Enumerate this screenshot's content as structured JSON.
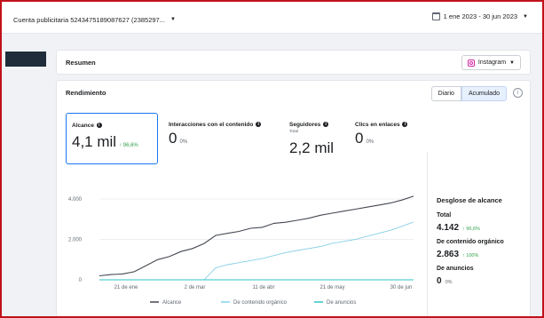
{
  "topbar": {
    "account_label": "Cuenta publicitaria 5243475189087627 (2385297...",
    "date_range": "1 ene 2023 - 30 jun 2023"
  },
  "summary": {
    "title": "Resumen",
    "platform_selector": "Instagram"
  },
  "performance": {
    "title": "Rendimiento",
    "toggle": [
      "Diario",
      "Acumulado"
    ],
    "metrics": [
      {
        "label": "Alcance",
        "value": "4,1 mil",
        "change": "↑ 96,6%",
        "selected": true
      },
      {
        "label": "Interacciones con el contenido",
        "value": "0",
        "change": "0%"
      },
      {
        "label": "Seguidores",
        "sublabel": "Total",
        "value": "2,2 mil",
        "change": ""
      },
      {
        "label": "Clics en enlaces",
        "value": "0",
        "change": "0%"
      }
    ]
  },
  "breakdown": {
    "title": "Desglose de alcance",
    "items": [
      {
        "label": "Total",
        "value": "4.142",
        "change": "↑ 96,6%"
      },
      {
        "label": "De contenido orgánico",
        "value": "2.863",
        "change": "↑ 100%"
      },
      {
        "label": "De anuncios",
        "value": "0",
        "change": "0%"
      }
    ]
  },
  "colors": {
    "alcance": "#444950",
    "organico": "#86d0e8",
    "anuncios": "#2ec6c6",
    "accent": "#1877f2",
    "positive": "#31a24c"
  },
  "chart_data": {
    "type": "line",
    "x": [
      "1 ene",
      "8 ene",
      "15 ene",
      "21 ene",
      "29 ene",
      "5 feb",
      "12 feb",
      "19 feb",
      "26 feb",
      "2 mar",
      "9 mar",
      "16 mar",
      "23 mar",
      "30 mar",
      "6 abr",
      "11 abr",
      "18 abr",
      "25 abr",
      "2 may",
      "9 may",
      "16 may",
      "21 may",
      "28 may",
      "4 jun",
      "11 jun",
      "18 jun",
      "25 jun",
      "30 jun"
    ],
    "x_ticks": [
      "21 de ene",
      "2 de mar",
      "11 de abr",
      "21 de may",
      "30 de jun"
    ],
    "y_ticks": [
      "0",
      "2.000",
      "4.000"
    ],
    "ylim": [
      0,
      4400
    ],
    "series": [
      {
        "name": "Alcance",
        "values": [
          200,
          260,
          290,
          400,
          700,
          1000,
          1150,
          1400,
          1550,
          1800,
          2200,
          2300,
          2400,
          2550,
          2600,
          2800,
          2850,
          2950,
          3050,
          3200,
          3300,
          3400,
          3500,
          3600,
          3700,
          3800,
          3950,
          4142
        ]
      },
      {
        "name": "De contenido orgánico",
        "values": [
          0,
          0,
          0,
          0,
          0,
          0,
          0,
          0,
          0,
          0,
          600,
          750,
          850,
          950,
          1050,
          1200,
          1350,
          1450,
          1550,
          1650,
          1800,
          1900,
          2000,
          2150,
          2300,
          2450,
          2650,
          2863
        ]
      },
      {
        "name": "De anuncios",
        "values": [
          0,
          0,
          0,
          0,
          0,
          0,
          0,
          0,
          0,
          0,
          0,
          0,
          0,
          0,
          0,
          0,
          0,
          0,
          0,
          0,
          0,
          0,
          0,
          0,
          0,
          0,
          0,
          0
        ]
      }
    ],
    "legend": [
      "Alcance",
      "De contenido orgánico",
      "De anuncios"
    ],
    "legend_position": "bottom",
    "grid": true
  }
}
